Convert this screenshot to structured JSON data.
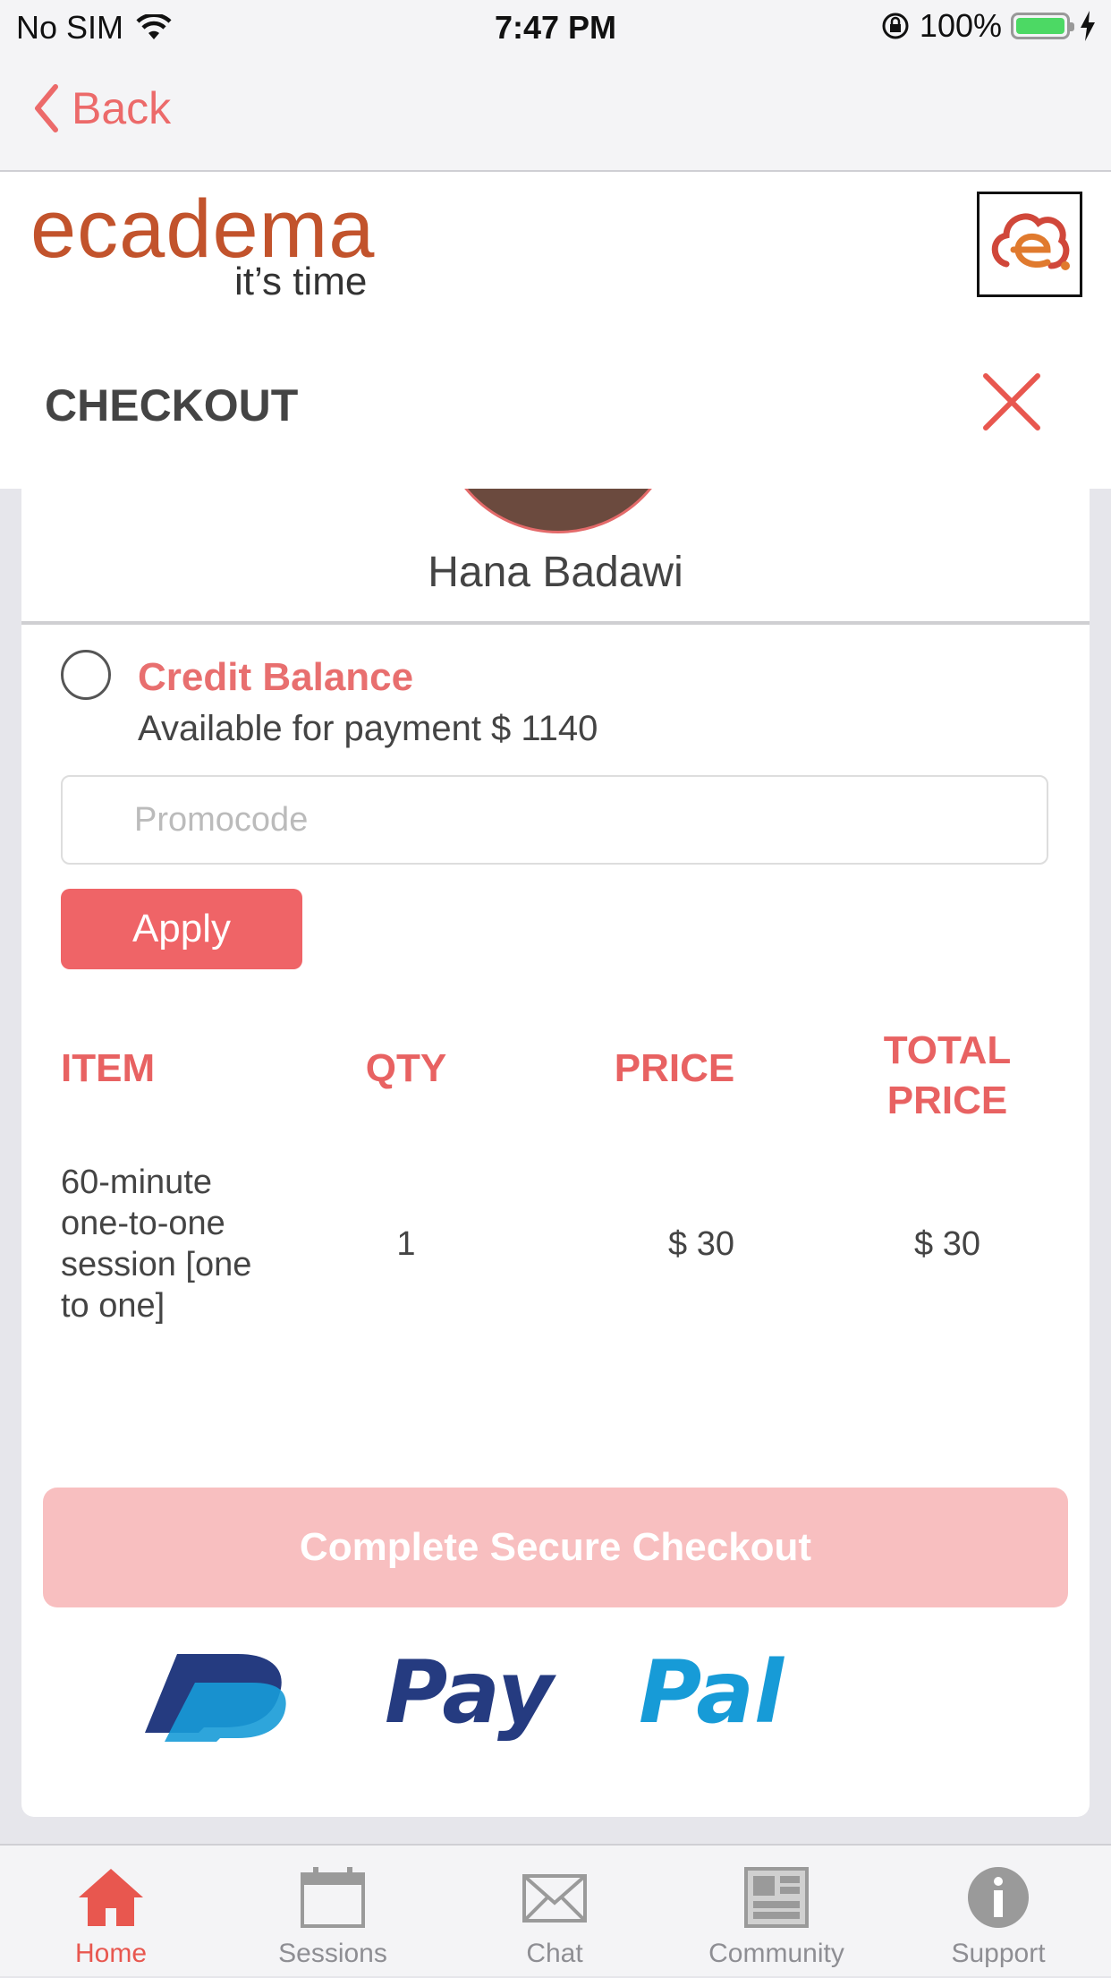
{
  "status_bar": {
    "carrier": "No SIM",
    "time": "7:47 PM",
    "battery": "100%"
  },
  "nav": {
    "back_label": "Back"
  },
  "brand": {
    "logo_text": "ecadema",
    "tagline": "it’s time"
  },
  "checkout": {
    "title": "CHECKOUT"
  },
  "tutor": {
    "name": "Hana Badawi"
  },
  "credit": {
    "title": "Credit Balance",
    "subtitle": "Available for payment $ 1140",
    "selected": false
  },
  "promo": {
    "placeholder": "Promocode",
    "value": "",
    "apply_label": "Apply"
  },
  "table": {
    "headers": {
      "item": "ITEM",
      "qty": "QTY",
      "price": "PRICE",
      "total_line1": "TOTAL",
      "total_line2": "PRICE"
    },
    "rows": [
      {
        "item": "60-minute one-to-one session [one to one]",
        "qty": "1",
        "price": "$ 30",
        "total": "$ 30"
      }
    ]
  },
  "checkout_button": "Complete Secure Checkout",
  "payment_provider": "PayPal",
  "tabs": [
    {
      "label": "Home",
      "icon": "home-icon",
      "active": true
    },
    {
      "label": "Sessions",
      "icon": "calendar-icon",
      "active": false
    },
    {
      "label": "Chat",
      "icon": "envelope-icon",
      "active": false
    },
    {
      "label": "Community",
      "icon": "community-icon",
      "active": false
    },
    {
      "label": "Support",
      "icon": "info-icon",
      "active": false
    }
  ],
  "colors": {
    "accent": "#ec6a6a",
    "button": "#ef6467",
    "checkout_disabled": "#f8bfc0",
    "paypal_dark": "#253b80",
    "paypal_light": "#179bd7"
  }
}
